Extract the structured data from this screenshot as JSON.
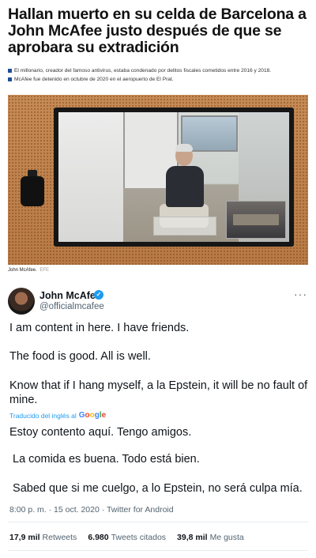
{
  "article": {
    "headline_lines": [
      "Hallan muerto en su celda de Barcelona a",
      "John McAfee justo después de que se",
      "aprobara su extradición"
    ],
    "bullets": [
      "El millonario, creador del famoso antivirus, estaba condenado por delitos fiscales cometidos entre 2016 y 2018.",
      "McAfee fue detenido en octubre de 2020 en el aeropuerto de El Prat."
    ],
    "bullet_color": "#1f4e96",
    "photo_caption": "John McAfee.",
    "photo_source": "EFE"
  },
  "tweet": {
    "display_name": "John McAfee",
    "verified_glyph": "✓",
    "handle": "@officialmcafee",
    "more_glyph": "···",
    "paragraphs": [
      "I am content in here. I have friends.",
      "The food is good. All is well.",
      "Know that if I hang myself, a la Epstein, it will be no fault of mine."
    ],
    "translated_by": "Traducido del inglés al",
    "translator_logo_letters": [
      "G",
      "o",
      "o",
      "g",
      "l",
      "e"
    ],
    "translation": [
      "Estoy contento aquí. Tengo amigos.",
      " La comida es buena. Todo está bien.",
      " Sabed que si me cuelgo, a lo Epstein, no será culpa mía."
    ],
    "meta": "8:00 p. m. · 15 oct. 2020 · Twitter for Android",
    "stats": [
      {
        "value": "17,9 mil",
        "label": "Retweets"
      },
      {
        "value": "6.980",
        "label": "Tweets citados"
      },
      {
        "value": "39,8 mil",
        "label": "Me gusta"
      }
    ],
    "accent_color": "#1d9bf0",
    "muted_color": "#536471"
  }
}
